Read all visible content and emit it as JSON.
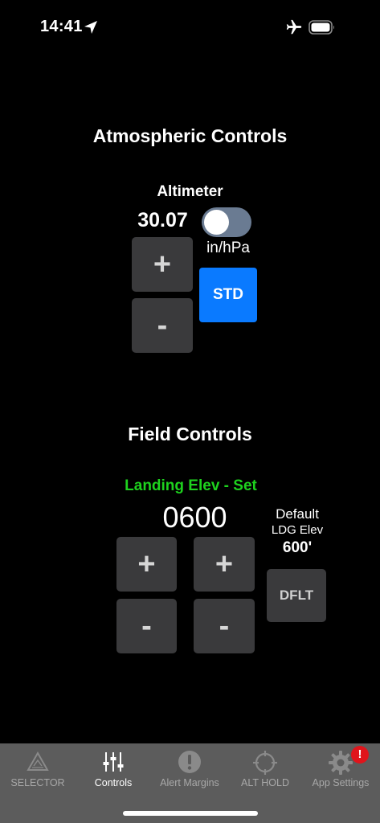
{
  "status": {
    "time": "14:41"
  },
  "atmos": {
    "title": "Atmospheric Controls",
    "altimeter_label": "Altimeter",
    "altimeter_value": "30.07",
    "units_label": "in/hPa",
    "toggle_on": false,
    "plus": "+",
    "minus": "-",
    "std_label": "STD"
  },
  "field": {
    "title": "Field Controls",
    "landing_label": "Landing Elev - Set",
    "landing_value": "0600",
    "default_label": "Default",
    "default_sub": "LDG Elev",
    "default_value": "600'",
    "plus": "+",
    "minus": "-",
    "dflt_label": "DFLT"
  },
  "colors": {
    "accent_blue": "#0a7aff",
    "landing_green": "#1ed21e",
    "badge_red": "#e0141b"
  },
  "tabbar": {
    "tabs": [
      {
        "label": "SELECTOR",
        "icon": "selector-triangle-icon"
      },
      {
        "label": "Controls",
        "icon": "sliders-icon",
        "active": true
      },
      {
        "label": "Alert Margins",
        "icon": "alert-exclamation-icon"
      },
      {
        "label": "ALT HOLD",
        "icon": "crosshair-icon"
      },
      {
        "label": "App Settings",
        "icon": "gear-icon"
      }
    ],
    "badge": "!"
  }
}
